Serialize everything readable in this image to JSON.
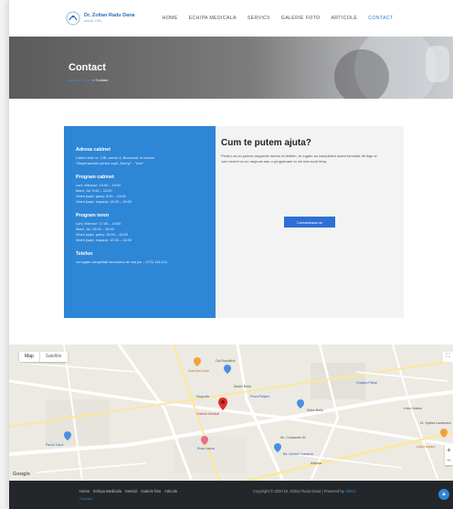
{
  "header": {
    "logo_name": "Dr. Zoltan Radu Dana",
    "logo_sub": "medic ORL",
    "nav": [
      {
        "label": "Home",
        "active": false
      },
      {
        "label": "Echipa medicala",
        "active": false
      },
      {
        "label": "Servicii",
        "active": false
      },
      {
        "label": "Galerie foto",
        "active": false
      },
      {
        "label": "Articole",
        "active": false
      },
      {
        "label": "Contact",
        "active": true
      }
    ]
  },
  "hero": {
    "title": "Contact",
    "breadcrumb_home": "Acasa / Home",
    "breadcrumb_current": "» Contact"
  },
  "info": {
    "address_title": "Adresa cabinet",
    "address_lines": [
      "Calea Unirii nr. 12B, sector 4, Bucuresti, în incinta",
      "\"Dispensarului pentru copii „Sunny“ - \"Uno\""
    ],
    "program_cabinet_title": "Program cabinet",
    "program_cabinet_lines": [
      "Luni, Miercuri: 14:00 – 19:00",
      "Marti, Joi: 9:00 – 13:00",
      "Vineri (sapt. para): 9:00 – 13:00",
      "Vineri (sapt. impara): 14:00 – 19:00"
    ],
    "program_teren_title": "Program teren",
    "program_teren_lines": [
      "Luni, Miercuri: 17:00 – 19:00",
      "Marti, Joi: 13:00 – 15:00",
      "Vineri (sapt. para): 13:00 – 15:00",
      "Vineri (sapt. impara): 12:00 – 14:00"
    ],
    "phone_title": "Telefon",
    "phone_line": "va rugam completati formularul de mai jos – 0721.118.113"
  },
  "help": {
    "title": "Cum te putem ajuta?",
    "text": "Pentru ca nu putem raspunde mereu la telefon, te rugam sa completezi acest formular de tiaje si vom reveni cu un raspuns sau o programare in cel mai scurt timp.",
    "button": "Contacteaza-ne"
  },
  "map": {
    "tab_map": "Map",
    "tab_satellite": "Satellite",
    "fullscreen": "⛶",
    "zoom_in": "+",
    "zoom_out": "−",
    "google": "Google",
    "pois": [
      {
        "label": "Dom Bon Dom",
        "cls": "orange"
      },
      {
        "label": "Cal Republicii",
        "cls": ""
      },
      {
        "label": "Cabinet Medical",
        "cls": "red"
      },
      {
        "label": "Pizza Rallyes",
        "cls": "blue"
      },
      {
        "label": "Studio Bella",
        "cls": ""
      },
      {
        "label": "Salon Bella",
        "cls": ""
      },
      {
        "label": "Rosa Vanea",
        "cls": "blue"
      },
      {
        "label": "Magnolia",
        "cls": "blue"
      },
      {
        "label": "Str. Constantin 81",
        "cls": ""
      },
      {
        "label": "Bd. Dimitrie Cantemir",
        "cls": "blue"
      },
      {
        "label": "Parcul Carol",
        "cls": "blue"
      },
      {
        "label": "Gradina Pitesti",
        "cls": "blue"
      },
      {
        "label": "Linia Ciolanu",
        "cls": ""
      },
      {
        "label": "Dr. Spelea Lazareanu",
        "cls": ""
      },
      {
        "label": "Linia Hoteluri",
        "cls": "orange"
      },
      {
        "label": "Antenia",
        "cls": ""
      }
    ]
  },
  "footer": {
    "links": [
      "Home",
      "Echipa Medicala",
      "Servicii",
      "Galerie foto",
      "Articole"
    ],
    "copyright": "Copyright © 2020 Dr. Zoltan Radu Dana | Powered by",
    "powered": "Vibral",
    "extra": "Contact",
    "top_icon": "arrow-up"
  },
  "colors": {
    "accent": "#2e86d6",
    "nav_active": "#2f7fd3",
    "footer_bg": "#23272b"
  }
}
